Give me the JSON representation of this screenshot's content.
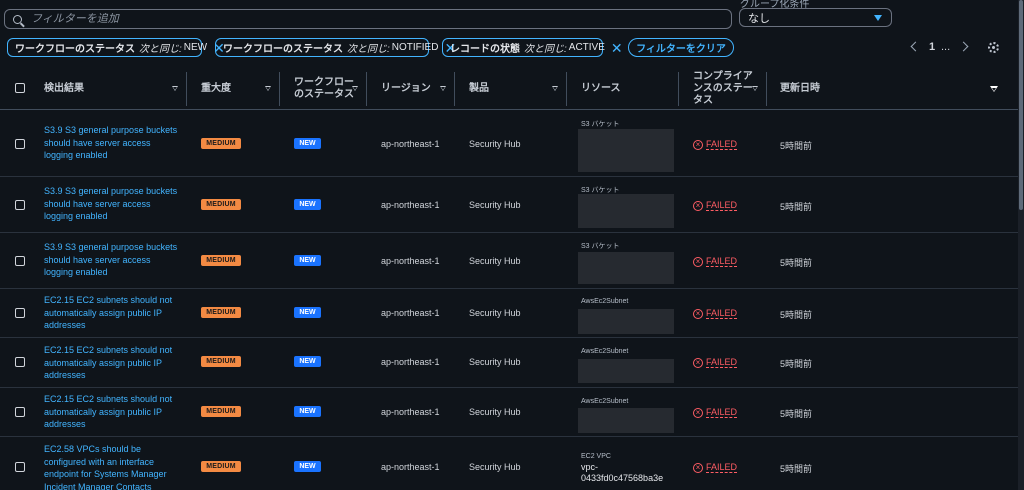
{
  "search": {
    "placeholder": "フィルターを追加"
  },
  "grouping": {
    "label": "グループ化条件",
    "value": "なし"
  },
  "filters": [
    {
      "key": "ワークフローのステータス",
      "op": "次と同じ:",
      "value": "NEW"
    },
    {
      "key": "ワークフローのステータス",
      "op": "次と同じ:",
      "value": "NOTIFIED"
    },
    {
      "key": "レコードの状態",
      "op": "次と同じ:",
      "value": "ACTIVE"
    }
  ],
  "clear_filters_label": "フィルターをクリア",
  "pagination": {
    "current": "1",
    "ellipsis": "..."
  },
  "columns": {
    "finding": "検出結果",
    "severity": "重大度",
    "workflow": [
      "ワークフロー",
      "のステータス"
    ],
    "region": "リージョン",
    "product": "製品",
    "resource": "リソース",
    "compliance": [
      "コンプライア",
      "ンスのステー",
      "タス"
    ],
    "updated": "更新日時"
  },
  "rows": [
    {
      "title": [
        "S3.9 S3 general purpose buckets",
        "should have server access",
        "logging enabled"
      ],
      "severity": "MEDIUM",
      "workflow": "NEW",
      "region": "ap-northeast-1",
      "product": "Security Hub",
      "resource_type": "S3 バケット",
      "resource_id": [],
      "compliance": "FAILED",
      "updated": "5時間前"
    },
    {
      "title": [
        "S3.9 S3 general purpose buckets",
        "should have server access",
        "logging enabled"
      ],
      "severity": "MEDIUM",
      "workflow": "NEW",
      "region": "ap-northeast-1",
      "product": "Security Hub",
      "resource_type": "S3 バケット",
      "resource_id": [],
      "compliance": "FAILED",
      "updated": "5時間前"
    },
    {
      "title": [
        "S3.9 S3 general purpose buckets",
        "should have server access",
        "logging enabled"
      ],
      "severity": "MEDIUM",
      "workflow": "NEW",
      "region": "ap-northeast-1",
      "product": "Security Hub",
      "resource_type": "S3 バケット",
      "resource_id": [],
      "compliance": "FAILED",
      "updated": "5時間前"
    },
    {
      "title": [
        "EC2.15 EC2 subnets should not",
        "automatically assign public IP",
        "addresses"
      ],
      "severity": "MEDIUM",
      "workflow": "NEW",
      "region": "ap-northeast-1",
      "product": "Security Hub",
      "resource_type": "AwsEc2Subnet",
      "resource_id": [],
      "compliance": "FAILED",
      "updated": "5時間前"
    },
    {
      "title": [
        "EC2.15 EC2 subnets should not",
        "automatically assign public IP",
        "addresses"
      ],
      "severity": "MEDIUM",
      "workflow": "NEW",
      "region": "ap-northeast-1",
      "product": "Security Hub",
      "resource_type": "AwsEc2Subnet",
      "resource_id": [],
      "compliance": "FAILED",
      "updated": "5時間前"
    },
    {
      "title": [
        "EC2.15 EC2 subnets should not",
        "automatically assign public IP",
        "addresses"
      ],
      "severity": "MEDIUM",
      "workflow": "NEW",
      "region": "ap-northeast-1",
      "product": "Security Hub",
      "resource_type": "AwsEc2Subnet",
      "resource_id": [],
      "compliance": "FAILED",
      "updated": "5時間前"
    },
    {
      "title": [
        "EC2.58 VPCs should be",
        "configured with an interface",
        "endpoint for Systems Manager",
        "Incident Manager Contacts"
      ],
      "severity": "MEDIUM",
      "workflow": "NEW",
      "region": "ap-northeast-1",
      "product": "Security Hub",
      "resource_type": "EC2 VPC",
      "resource_id": [
        "vpc-",
        "0433fd0c47568ba3e"
      ],
      "compliance": "FAILED",
      "updated": "5時間前"
    }
  ],
  "colors": {
    "accent": "#42b4ff",
    "medium": "#f38a43",
    "new": "#1a73ff",
    "failed": "#ff5d64",
    "background": "#0f141a"
  }
}
